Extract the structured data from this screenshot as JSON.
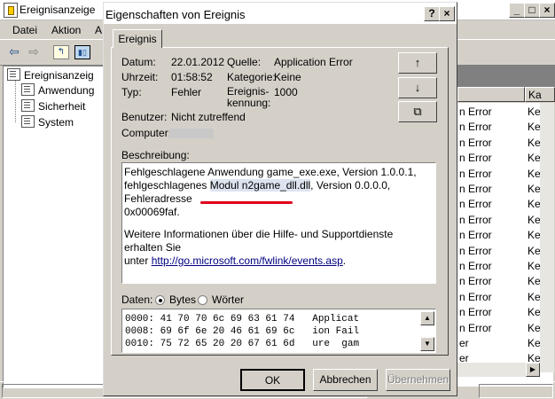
{
  "bg_window": {
    "title": "Ereignisanzeige",
    "menu": [
      "Datei",
      "Aktion",
      "A"
    ],
    "tree": [
      "Ereignisanzeig",
      "Anwendung",
      "Sicherheit",
      "System"
    ],
    "list_header": [
      "Ka"
    ],
    "rows": [
      {
        "source": "n Error",
        "cat": "Ke"
      },
      {
        "source": "n Error",
        "cat": "Ke"
      },
      {
        "source": "n Error",
        "cat": "Ke"
      },
      {
        "source": "n Error",
        "cat": "Ke"
      },
      {
        "source": "n Error",
        "cat": "Ke"
      },
      {
        "source": "n Error",
        "cat": "Ke"
      },
      {
        "source": "n Error",
        "cat": "Ke"
      },
      {
        "source": "n Error",
        "cat": "Ke"
      },
      {
        "source": "n Error",
        "cat": "Ke"
      },
      {
        "source": "n Error",
        "cat": "Ke"
      },
      {
        "source": "n Error",
        "cat": "Ke"
      },
      {
        "source": "n Error",
        "cat": "Ke"
      },
      {
        "source": "n Error",
        "cat": "Ke"
      },
      {
        "source": "n Error",
        "cat": "Ke"
      },
      {
        "source": "n Error",
        "cat": "Ke"
      },
      {
        "source": "er",
        "cat": "Ke"
      },
      {
        "source": "er",
        "cat": "Ke"
      }
    ]
  },
  "dialog": {
    "title": "Eigenschaften von Ereignis",
    "help_label": "?",
    "close_label": "×",
    "tab": "Ereignis",
    "fields": {
      "datum_label": "Datum:",
      "datum_value": "22.01.2012",
      "uhrzeit_label": "Uhrzeit:",
      "uhrzeit_value": "01:58:52",
      "typ_label": "Typ:",
      "typ_value": "Fehler",
      "benutzer_label": "Benutzer:",
      "benutzer_value": "Nicht zutreffend",
      "computer_label": "Computer:",
      "quelle_label": "Quelle:",
      "quelle_value": "Application Error",
      "kategorie_label": "Kategorie:",
      "kategorie_value": "Keine",
      "kennung_label_1": "Ereignis-",
      "kennung_label_2": "kennung:",
      "kennung_value": "1000"
    },
    "description_label": "Beschreibung:",
    "description": {
      "line1": "Fehlgeschlagene Anwendung game_exe.exe, Version 1.0.0.1,",
      "line2_pre": "fehlgeschlagenes ",
      "line2_hl": "Modul n2game_dll.dll",
      "line2_post": ", Version 0.0.0.0, Fehleradresse",
      "line3": "0x00069faf.",
      "line4": "Weitere Informationen über die Hilfe- und Supportdienste erhalten Sie",
      "line5_pre": "unter ",
      "line5_link": "http://go.microsoft.com/fwlink/events.asp",
      "line5_post": "."
    },
    "data_label": "Daten:",
    "bytes_label": "Bytes",
    "words_label": "Wörter",
    "hex_lines": [
      "0000: 41 70 70 6c 69 63 61 74   Applicat",
      "0008: 69 6f 6e 20 46 61 69 6c   ion Fail",
      "0010: 75 72 65 20 20 67 61 6d   ure  gam"
    ],
    "buttons": {
      "ok": "OK",
      "cancel": "Abbrechen",
      "apply": "Übernehmen"
    },
    "side_buttons": {
      "up": "↑",
      "down": "↓",
      "copy": "⧉"
    }
  },
  "colors": {
    "annotation_underline": "#e0001a",
    "highlight": "#dde4f0",
    "link": "#000080"
  }
}
